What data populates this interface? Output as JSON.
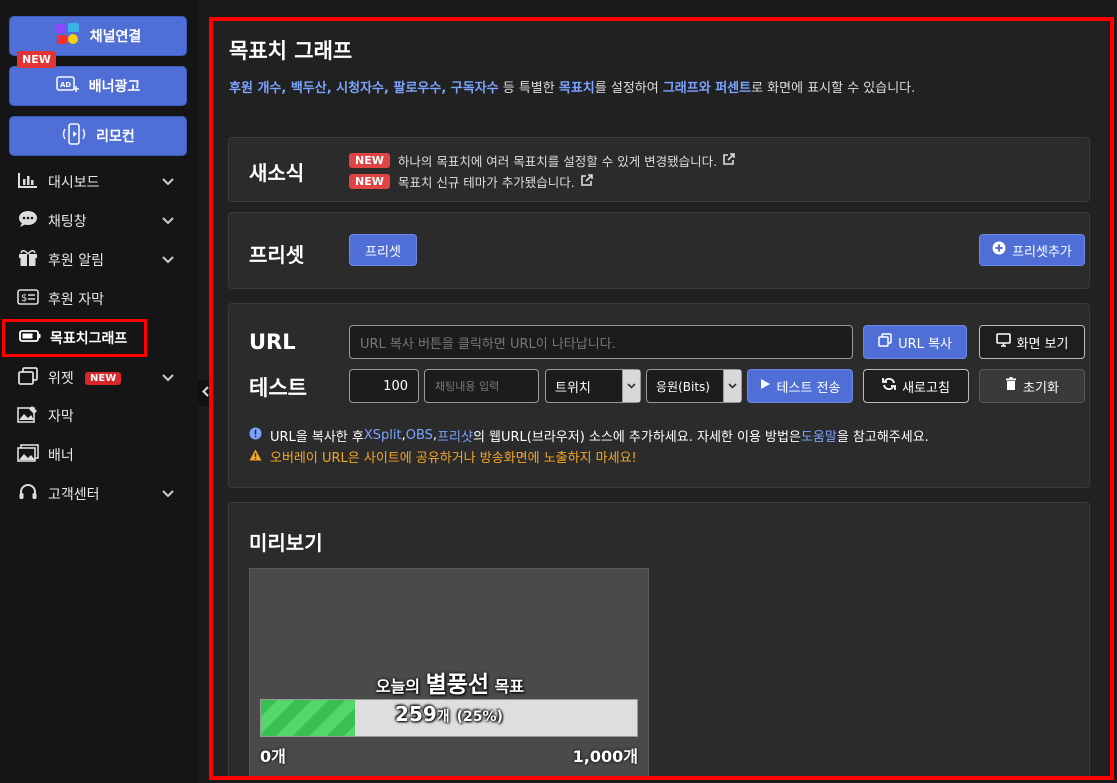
{
  "sidebar": {
    "buttons": [
      {
        "label": "채널연결",
        "icon": "channel-icons"
      },
      {
        "label": "배너광고",
        "icon": "ad-plus-icon"
      },
      {
        "label": "리모컨",
        "icon": "remote-icon"
      }
    ],
    "new_badge": "NEW",
    "menu": [
      {
        "label": "대시보드",
        "icon": "chart-icon",
        "chevron": true
      },
      {
        "label": "채팅창",
        "icon": "chat-icon",
        "chevron": true
      },
      {
        "label": "후원 알림",
        "icon": "gift-icon",
        "chevron": true
      },
      {
        "label": "후원 자막",
        "icon": "dollar-caption-icon",
        "chevron": false
      },
      {
        "label": "목표치그래프",
        "icon": "battery-icon",
        "chevron": false,
        "active": true
      },
      {
        "label": "위젯",
        "icon": "widget-icon",
        "chevron": true,
        "badge": "NEW"
      },
      {
        "label": "자막",
        "icon": "caption-image-icon",
        "chevron": false
      },
      {
        "label": "배너",
        "icon": "banner-image-icon",
        "chevron": false
      },
      {
        "label": "고객센터",
        "icon": "headset-icon",
        "chevron": true
      }
    ]
  },
  "page": {
    "title": "목표치 그래프",
    "desc_highlight1": "후원 개수, 백두산, 시청자수, 팔로우수, 구독자수",
    "desc_text1": " 등 특별한 ",
    "desc_highlight2": "목표치",
    "desc_text2": "를 설정하여 ",
    "desc_highlight3": "그래프와 퍼센트",
    "desc_text3": "로 화면에 표시할 수 있습니다."
  },
  "news": {
    "title": "새소식",
    "items": [
      {
        "badge": "NEW",
        "text": "하나의 목표치에 여러 목표치를 설정할 수 있게 변경됐습니다."
      },
      {
        "badge": "NEW",
        "text": "목표치 신규 테마가 추가됐습니다."
      }
    ]
  },
  "preset": {
    "title": "프리셋",
    "preset_button": "프리셋",
    "add_button": "프리셋추가"
  },
  "url_section": {
    "url_label": "URL",
    "url_placeholder": "URL 복사 버튼을 클릭하면 URL이 나타납니다.",
    "copy_button": "URL 복사",
    "view_button": "화면 보기",
    "test_label": "테스트",
    "amount_value": "100",
    "chat_placeholder": "채팅내용 입력",
    "platform_select": "트위치",
    "type_select": "응원(Bits)",
    "send_button": "테스트 전송",
    "refresh_button": "새로고침",
    "reset_button": "초기화",
    "info_prefix": "URL을 복사한 후 ",
    "info_xsplit": "XSplit",
    "info_obs": "OBS",
    "info_prism": "프리샷",
    "info_mid": "의 웹URL(브라우저) 소스에 추가하세요. 자세한 이용 방법은 ",
    "info_help": "도움말",
    "info_suffix": "을 참고해주세요.",
    "warning": "오버레이 URL은 사이트에 공유하거나 방송화면에 노출하지 마세요!",
    "comma": ", "
  },
  "preview": {
    "title": "미리보기",
    "goal_prefix": "오늘의",
    "goal_name": "별풍선",
    "goal_suffix": "목표",
    "current": "259",
    "unit": "개",
    "percent_text": "(25%)",
    "progress_fraction": 0.25,
    "min_label": "0개",
    "max_label": "1,000개"
  },
  "colors": {
    "accent_blue": "#4f6fd6",
    "highlight": "#7ba3ff",
    "new_red": "#e04444",
    "warn": "#f5a623",
    "progress_green": "#38c053",
    "selection_red": "#ff0000"
  }
}
